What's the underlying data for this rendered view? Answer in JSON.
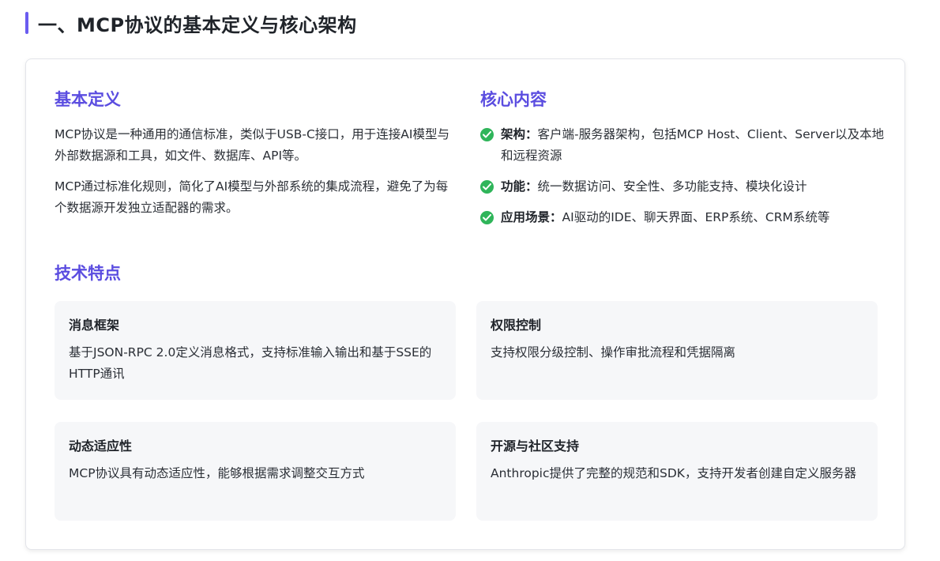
{
  "section": {
    "title": "一、MCP协议的基本定义与核心架构"
  },
  "definition": {
    "heading": "基本定义",
    "paragraphs": [
      "MCP协议是一种通用的通信标准，类似于USB-C接口，用于连接AI模型与外部数据源和工具，如文件、数据库、API等。",
      "MCP通过标准化规则，简化了AI模型与外部系统的集成流程，避免了为每个数据源开发独立适配器的需求。"
    ]
  },
  "core": {
    "heading": "核心内容",
    "items": [
      {
        "label": "架构：",
        "text": "客户端-服务器架构，包括MCP Host、Client、Server以及本地和远程资源"
      },
      {
        "label": "功能：",
        "text": "统一数据访问、安全性、多功能支持、模块化设计"
      },
      {
        "label": "应用场景：",
        "text": "AI驱动的IDE、聊天界面、ERP系统、CRM系统等"
      }
    ]
  },
  "tech": {
    "heading": "技术特点",
    "features": [
      {
        "title": "消息框架",
        "desc": "基于JSON-RPC 2.0定义消息格式，支持标准输入输出和基于SSE的HTTP通讯"
      },
      {
        "title": "权限控制",
        "desc": "支持权限分级控制、操作审批流程和凭据隔离"
      },
      {
        "title": "动态适应性",
        "desc": "MCP协议具有动态适应性，能够根据需求调整交互方式"
      },
      {
        "title": "开源与社区支持",
        "desc": "Anthropic提供了完整的规范和SDK，支持开发者创建自定义服务器"
      }
    ]
  },
  "colors": {
    "accent": "#5b4de0",
    "title_bar": "#6a5cf0",
    "check": "#2fb55a",
    "feature_bg": "#f6f7f9"
  },
  "icons": {
    "bullet": "check-circle-icon"
  }
}
